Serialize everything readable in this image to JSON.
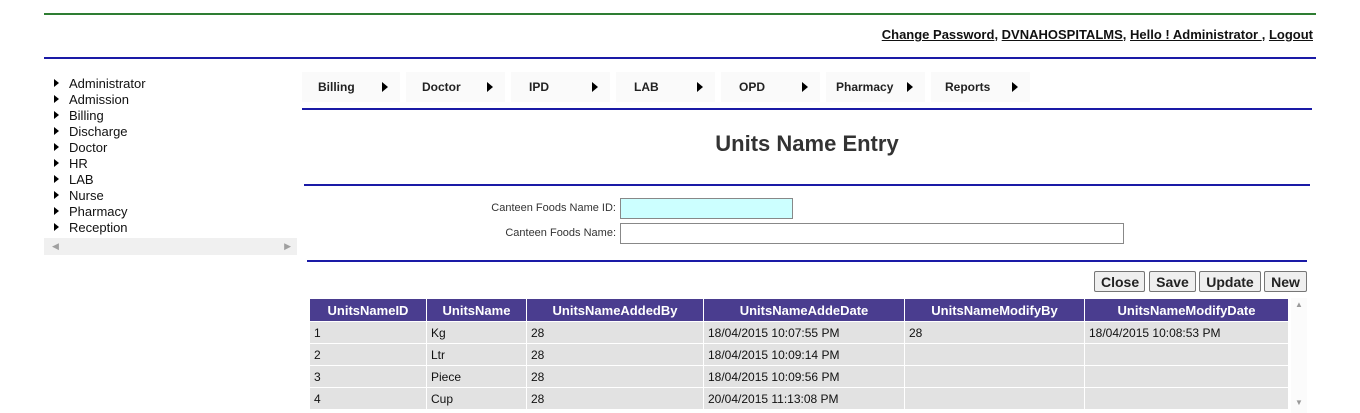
{
  "header": {
    "change_password": "Change Password",
    "separator1": ", ",
    "username": "DVNAHOSPITALMS",
    "separator2": ", ",
    "greeting": "Hello ! Administrator ",
    "separator3": ", ",
    "logout": "Logout"
  },
  "sidebar": {
    "items": [
      {
        "label": "Administrator"
      },
      {
        "label": "Admission"
      },
      {
        "label": "Billing"
      },
      {
        "label": "Discharge"
      },
      {
        "label": "Doctor"
      },
      {
        "label": "HR"
      },
      {
        "label": "LAB"
      },
      {
        "label": "Nurse"
      },
      {
        "label": "Pharmacy"
      },
      {
        "label": "Reception"
      }
    ]
  },
  "menu": {
    "tabs": [
      {
        "label": "Billing"
      },
      {
        "label": "Doctor"
      },
      {
        "label": "IPD"
      },
      {
        "label": "LAB"
      },
      {
        "label": "OPD"
      },
      {
        "label": "Pharmacy"
      },
      {
        "label": "Reports"
      }
    ]
  },
  "page": {
    "title": "Units Name Entry"
  },
  "form": {
    "id_label": "Canteen Foods Name ID:",
    "id_value": "",
    "name_label": "Canteen Foods Name:",
    "name_value": ""
  },
  "buttons": {
    "close": "Close",
    "save": "Save",
    "update": "Update",
    "new": "New"
  },
  "grid": {
    "headers": [
      "UnitsNameID",
      "UnitsName",
      "UnitsNameAddedBy",
      "UnitsNameAddeDate",
      "UnitsNameModifyBy",
      "UnitsNameModifyDate"
    ],
    "rows": [
      [
        "1",
        "Kg",
        "28",
        "18/04/2015 10:07:55 PM",
        "28",
        "18/04/2015 10:08:53 PM"
      ],
      [
        "2",
        "Ltr",
        "28",
        "18/04/2015 10:09:14 PM",
        "",
        ""
      ],
      [
        "3",
        "Piece",
        "28",
        "18/04/2015 10:09:56 PM",
        "",
        ""
      ],
      [
        "4",
        "Cup",
        "28",
        "20/04/2015 11:13:08 PM",
        "",
        ""
      ]
    ]
  },
  "colors": {
    "grid_header": "#4a3d8f",
    "rule_blue": "#1a1aa6",
    "rule_green": "#2e7d32",
    "id_input_bg": "#ccffff"
  }
}
